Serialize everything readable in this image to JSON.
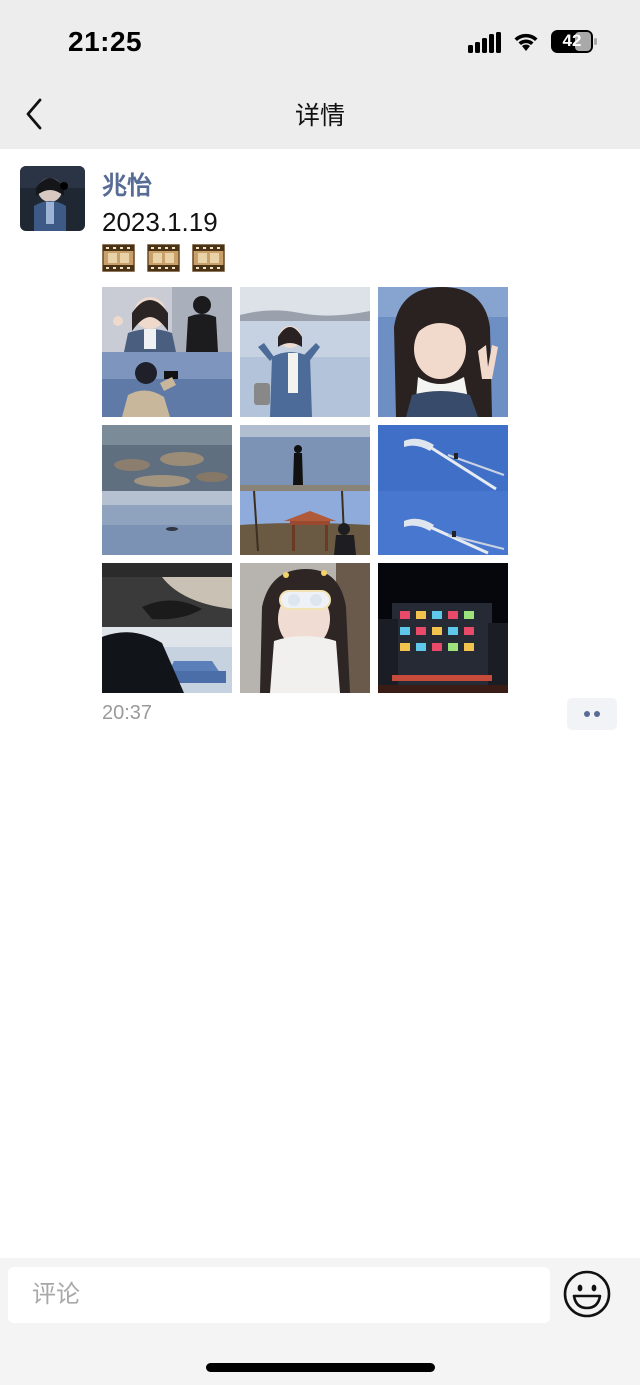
{
  "status_bar": {
    "time": "21:25",
    "battery": "42"
  },
  "nav": {
    "title": "详情"
  },
  "post": {
    "author": "兆怡",
    "text": "2023.1.19",
    "time": "20:37",
    "emoji_icons": [
      "film-icon",
      "film-icon",
      "film-icon"
    ]
  },
  "comment_bar": {
    "placeholder": "评论"
  },
  "colors": {
    "author_link": "#576b95",
    "nav_background": "#ededed",
    "muted_text": "#9a9a9a"
  }
}
